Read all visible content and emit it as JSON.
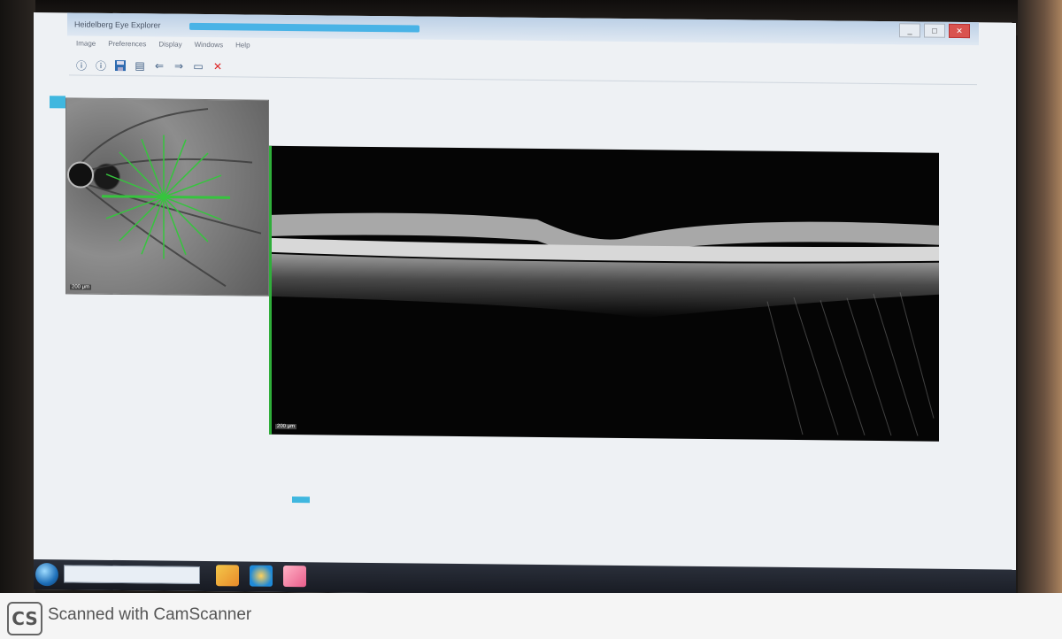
{
  "window": {
    "title": "Heidelberg Eye Explorer",
    "win_min": "_",
    "win_max": "□",
    "win_close": "✕"
  },
  "menu": [
    "Image",
    "Preferences",
    "Display",
    "Windows",
    "Help"
  ],
  "toolbar": {
    "icons": [
      "info-icon",
      "info-icon",
      "save-icon",
      "print-icon",
      "arrow-left-icon",
      "arrow-right-icon",
      "copy-icon",
      "delete-icon"
    ]
  },
  "fundus": {
    "scale_label": "200 μm"
  },
  "oct": {
    "scale_label": "200 μm",
    "border_color": "#2fae3a"
  },
  "bottombar": {
    "items": [
      "",
      "",
      "",
      ""
    ],
    "selected": ""
  },
  "taskbar": {
    "search_placeholder": ""
  },
  "footer": {
    "logo_text": "CS",
    "text": "Scanned with CamScanner"
  },
  "colors": {
    "accent": "#3fb7df",
    "scan_green": "#2fae3a",
    "delete_red": "#d22222"
  }
}
